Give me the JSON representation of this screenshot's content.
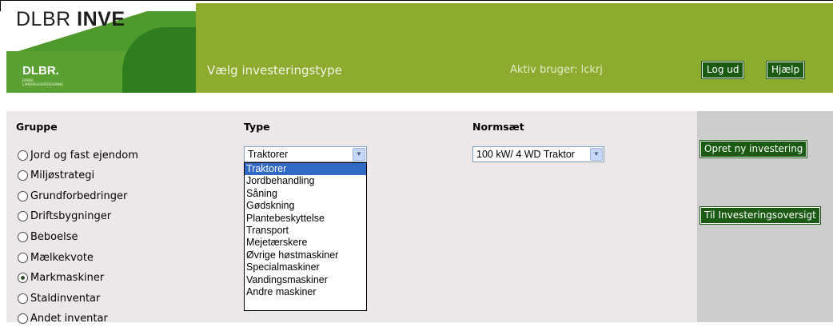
{
  "header": {
    "app_title_light": "DLBR ",
    "app_title_bold": "INVE",
    "logo_text": "DLBR.",
    "logo_subtext": "DANSK LANDBRUGSRÅDGIVNING",
    "page_heading": "Vælg investeringstype",
    "active_user": "Aktiv bruger: lckrj",
    "logout_label": "Log ud",
    "help_label": "Hjælp"
  },
  "columns": {
    "group_label": "Gruppe",
    "type_label": "Type",
    "norm_label": "Normsæt"
  },
  "groups": [
    {
      "label": "Jord og fast ejendom",
      "checked": false
    },
    {
      "label": "Miljøstrategi",
      "checked": false
    },
    {
      "label": "Grundforbedringer",
      "checked": false
    },
    {
      "label": "Driftsbygninger",
      "checked": false
    },
    {
      "label": "Beboelse",
      "checked": false
    },
    {
      "label": "Mælkekvote",
      "checked": false
    },
    {
      "label": "Markmaskiner",
      "checked": true
    },
    {
      "label": "Staldinventar",
      "checked": false
    },
    {
      "label": "Andet inventar",
      "checked": false
    }
  ],
  "type_select": {
    "value": "Traktorer",
    "options": [
      "Traktorer",
      "Jordbehandling",
      "Såning",
      "Gødskning",
      "Plantebeskyttelse",
      "Transport",
      "Mejetærskere",
      "Øvrige høstmaskiner",
      "Specialmaskiner",
      "Vandingsmaskiner",
      "Andre maskiner"
    ]
  },
  "norm_select": {
    "value": "100 kW/ 4 WD Traktor"
  },
  "side": {
    "create_label": "Opret ny investering",
    "overview_label": "Til Investeringsoversigt"
  },
  "colors": {
    "header_green": "#8dab2e",
    "button_green": "#1a5a12",
    "selection_blue": "#316ac5"
  }
}
